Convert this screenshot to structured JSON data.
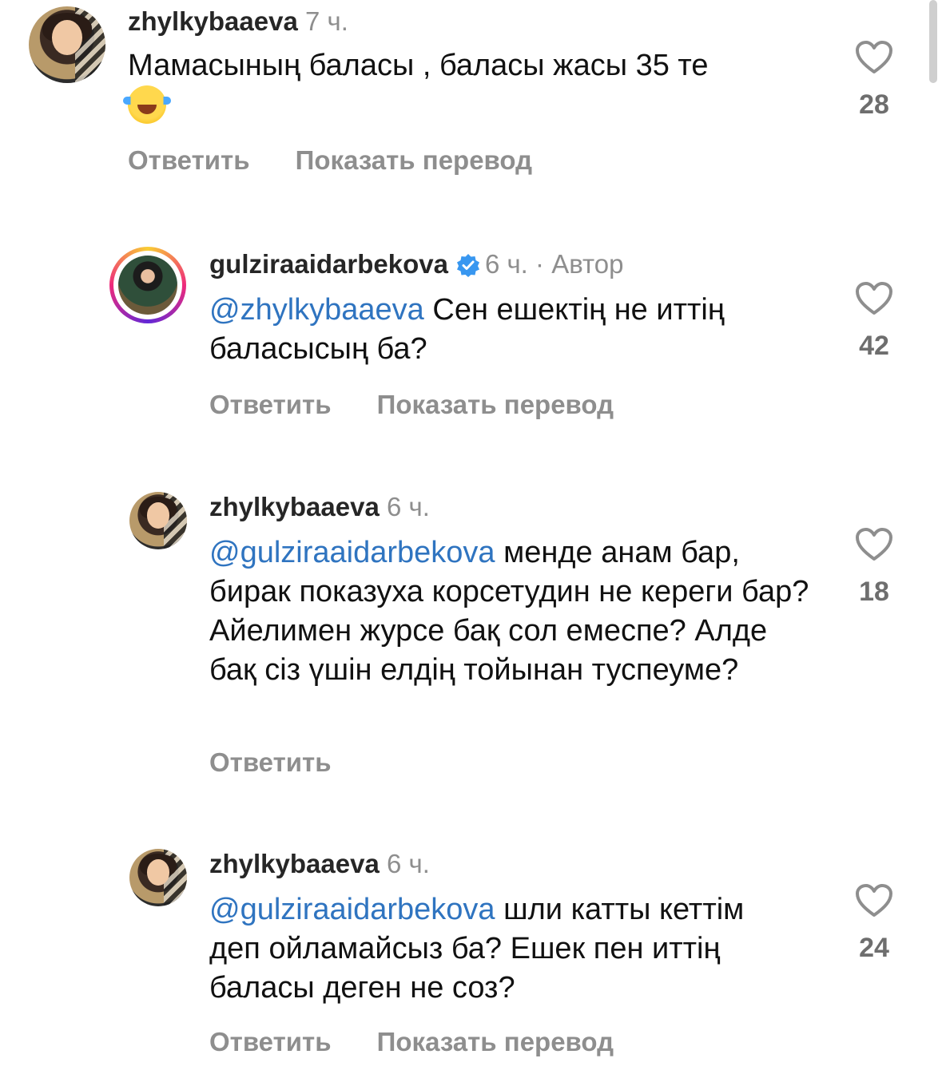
{
  "comments": [
    {
      "username": "zhylkybaaeva",
      "time": "7 ч.",
      "text_before_emoji": "Мамасының баласы , баласы жасы 35 те",
      "emoji": "face-with-tears-of-joy",
      "likes": "28",
      "reply_label": "Ответить",
      "translate_label": "Показать перевод"
    },
    {
      "username": "gulziraaidarbekova",
      "time": "6 ч.",
      "separator": "·",
      "author_badge": "Автор",
      "mention": "@zhylkybaaeva",
      "text": " Сен ешектің не иттің баласысың ба?",
      "likes": "42",
      "reply_label": "Ответить",
      "translate_label": "Показать перевод"
    },
    {
      "username": "zhylkybaaeva",
      "time": "6 ч.",
      "mention": "@gulziraaidarbekova",
      "text": " менде анам бар, бирак показуха корсетудин не кереги бар? Айелимен журсе бақ сол емеспе? Алде бақ сіз үшін елдің тойынан туспеуме?",
      "likes": "18",
      "reply_label": "Ответить"
    },
    {
      "username": "zhylkybaaeva",
      "time": "6 ч.",
      "mention": "@gulziraaidarbekova",
      "text": " шли катты кеттім деп ойламайсыз ба? Ешек пен иттің баласы деген не соз?",
      "likes": "24",
      "reply_label": "Ответить",
      "translate_label": "Показать перевод"
    }
  ],
  "icons": {
    "like": "heart-outline-icon",
    "verified": "verified-badge-icon"
  },
  "colors": {
    "mention": "#2f74c0",
    "meta": "#8e8e8e",
    "verified": "#3897f0"
  }
}
